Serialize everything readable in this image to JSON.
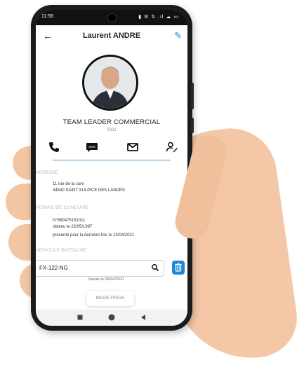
{
  "status_bar": {
    "time": "11:56",
    "icons_text": "▮ ⚙ ⇅ .ıl ☁ ▭"
  },
  "header": {
    "title": "Laurent ANDRE",
    "back_icon": "arrow-left-icon",
    "edit_icon": "pencil-icon"
  },
  "profile": {
    "role": "TEAM LEADER COMMERCIAL",
    "code": "0021",
    "avatar_icon": "profile-photo"
  },
  "actions": [
    {
      "name": "phone-icon"
    },
    {
      "name": "sms-icon",
      "label": "SMS"
    },
    {
      "name": "mail-icon"
    },
    {
      "name": "user-edit-icon"
    }
  ],
  "address": {
    "label": "ADRESSE",
    "line1": "11 rue de la cure",
    "line2": "44540 SAINT SULPICE DES LANDES"
  },
  "license": {
    "label": "PERMIS DE CONDUIRE",
    "number": "N°880475151011",
    "obtained": "obtenu le 22/05/1997",
    "presented": "présenté pour la dernière fois le 13/04/2021"
  },
  "vehicle": {
    "label": "VEHICULE RATTACHE",
    "plate": "FX-122-NG",
    "since": "Depuis le 06/04/2021"
  },
  "mode_button": {
    "label": "MODE PRIVE"
  },
  "colors": {
    "accent": "#1e88d6",
    "phone_body": "#1b1b1b",
    "skin": "#f4c8a6"
  }
}
